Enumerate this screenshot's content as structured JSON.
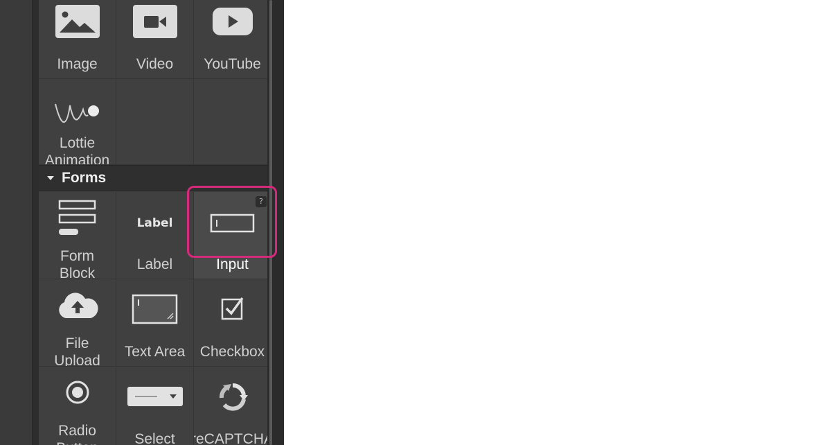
{
  "media": {
    "image_label": "Image",
    "video_label": "Video",
    "youtube_label": "YouTube",
    "lottie_label": "Lottie\nAnimation"
  },
  "forms": {
    "section_title": "Forms",
    "form_block_label": "Form\nBlock",
    "label_label": "Label",
    "label_icon_text": "Label",
    "input_label": "Input",
    "input_help": "?",
    "file_upload_label": "File\nUpload",
    "text_area_label": "Text Area",
    "checkbox_label": "Checkbox",
    "radio_label": "Radio\nButton",
    "select_label": "Select",
    "recaptcha_label": "reCAPTCHA"
  },
  "colors": {
    "panel_bg": "#404040",
    "highlight": "#d42a7c",
    "canvas_bg": "#ffffff"
  }
}
